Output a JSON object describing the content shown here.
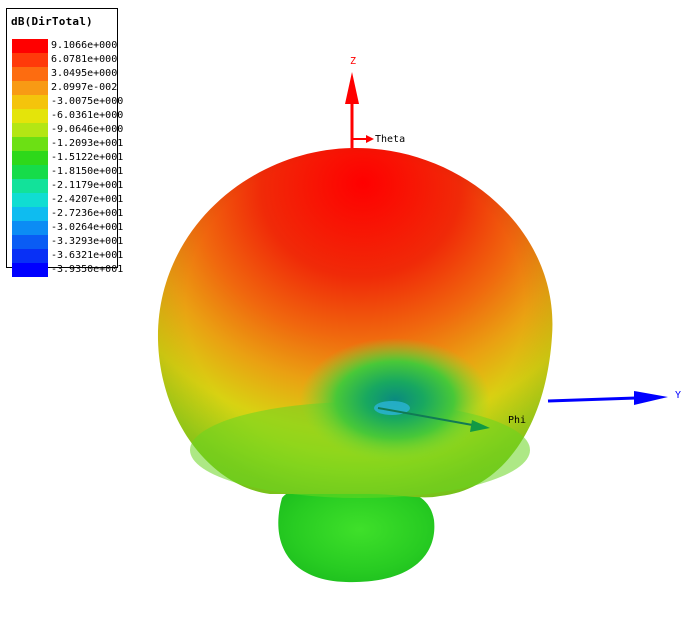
{
  "legend": {
    "title": "dB(DirTotal)",
    "entries": [
      {
        "label": "9.1066e+000",
        "color": "#ff0000"
      },
      {
        "label": "6.0781e+000",
        "color": "#ff3a0a"
      },
      {
        "label": "3.0495e+000",
        "color": "#fd6c10"
      },
      {
        "label": "2.0997e-002",
        "color": "#f89a14"
      },
      {
        "label": "-3.0075e+000",
        "color": "#f4c40c"
      },
      {
        "label": "-6.0361e+000",
        "color": "#e4e40a"
      },
      {
        "label": "-9.0646e+000",
        "color": "#b4e614"
      },
      {
        "label": "-1.2093e+001",
        "color": "#6ce014"
      },
      {
        "label": "-1.5122e+001",
        "color": "#2ed81a"
      },
      {
        "label": "-1.8150e+001",
        "color": "#16dc4a"
      },
      {
        "label": "-2.1179e+001",
        "color": "#12e29a"
      },
      {
        "label": "-2.4207e+001",
        "color": "#10ddd2"
      },
      {
        "label": "-2.7236e+001",
        "color": "#0ebcf0"
      },
      {
        "label": "-3.0264e+001",
        "color": "#0c8cf4"
      },
      {
        "label": "-3.3293e+001",
        "color": "#0a5cf4"
      },
      {
        "label": "-3.6321e+001",
        "color": "#0830f6"
      },
      {
        "label": "-3.9350e+001",
        "color": "#0000ff"
      }
    ]
  },
  "axes": {
    "z_label": "Z",
    "y_label": "Y",
    "theta_label": "Theta",
    "phi_label": "Phi",
    "z_color": "#ff0000",
    "y_color": "#0000ff",
    "phi_color": "#00aa00"
  }
}
